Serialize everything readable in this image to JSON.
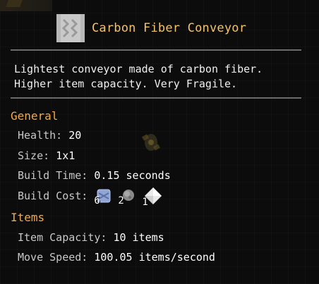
{
  "block": {
    "name": "Carbon Fiber Conveyor",
    "icon": "conveyor-block-icon",
    "description": "Lightest conveyor made of carbon fiber. Higher item capacity. Very Fragile."
  },
  "general": {
    "heading": "General",
    "health_label": "Health:",
    "health_value": "20",
    "size_label": "Size:",
    "size_value": "1x1",
    "build_time_label": "Build Time:",
    "build_time_value": "0.15 seconds",
    "build_cost_label": "Build Cost:",
    "build_cost": [
      {
        "amount": "6",
        "icon": "carbon-fiber-icon",
        "color": "#8fa6d6"
      },
      {
        "amount": "2",
        "icon": "metal-ore-icon",
        "color": "#8a8a8a"
      },
      {
        "amount": "1",
        "icon": "crystal-icon",
        "color": "#eaeaea"
      }
    ]
  },
  "items": {
    "heading": "Items",
    "capacity_label": "Item Capacity:",
    "capacity_value": "10 items",
    "speed_label": "Move Speed:",
    "speed_value": "100.05 items/second"
  },
  "colors": {
    "title": "#f2c36b",
    "section": "#f2a94b",
    "divider": "#6b6b6b",
    "background": "#0c0c0c"
  }
}
